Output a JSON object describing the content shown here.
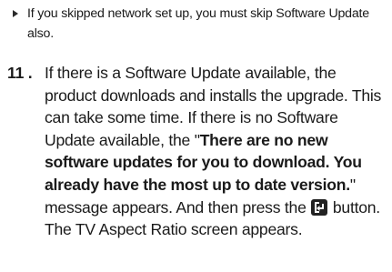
{
  "note": {
    "text": "If you skipped network set up, you must skip Software Update also."
  },
  "step": {
    "number": "11 .",
    "text_1": "If there is a Software Update available, the product downloads and installs the upgrade. This can take some time. If there is no Software Update available, the \"",
    "bold": "There are no new software updates for you to download. You already have the most up to date version.",
    "text_2": "\" message appears. And then press the ",
    "icon": "enter-key-icon",
    "text_3": " button. The TV Aspect Ratio screen appears."
  }
}
